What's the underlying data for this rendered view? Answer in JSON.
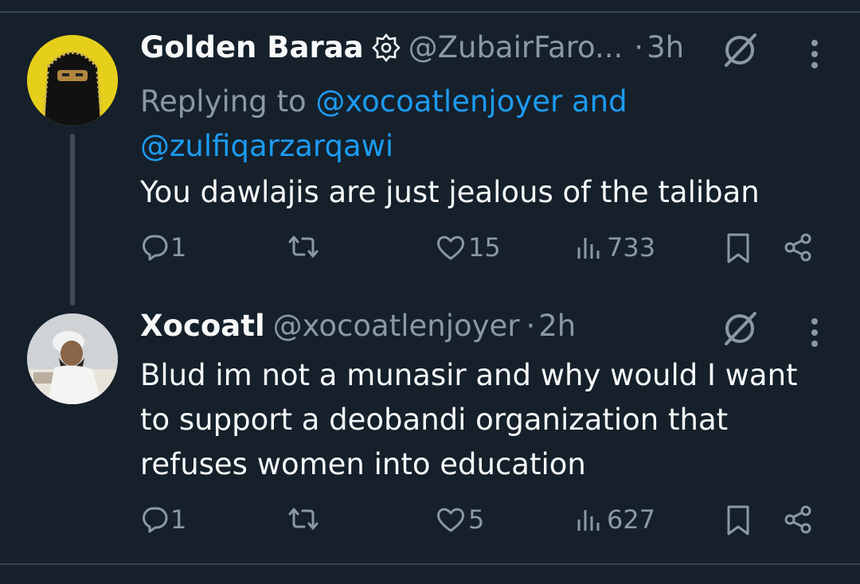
{
  "tweets": [
    {
      "name": "Golden Baraa",
      "handle": "@ZubairFaro...",
      "separator": "·",
      "time": "3h",
      "reply_prefix": "Replying to ",
      "reply_user1": "@xocoatlenjoyer",
      "reply_and": " and",
      "reply_user2": "@zulfiqarzarqawi",
      "text": "You dawlajis are just jealous of the taliban",
      "replies": "1",
      "likes": "15",
      "views": "733"
    },
    {
      "name": "Xocoatl",
      "handle": "@xocoatlenjoyer",
      "separator": "·",
      "time": "2h",
      "text": "Blud im not a munasir and why would I want to support a deobandi organization that refuses women into education",
      "replies": "1",
      "likes": "5",
      "views": "627"
    }
  ],
  "icons": {
    "reply": "reply-icon",
    "retweet": "retweet-icon",
    "like": "heart-icon",
    "views": "views-icon",
    "bookmark": "bookmark-icon",
    "share": "share-icon",
    "grok": "grok-icon",
    "more": "more-icon",
    "verified": "verified-badge-icon"
  },
  "colors": {
    "background": "#15202b",
    "text": "#f7f9f9",
    "muted": "#8b98a5",
    "link": "#1d9bf0"
  }
}
